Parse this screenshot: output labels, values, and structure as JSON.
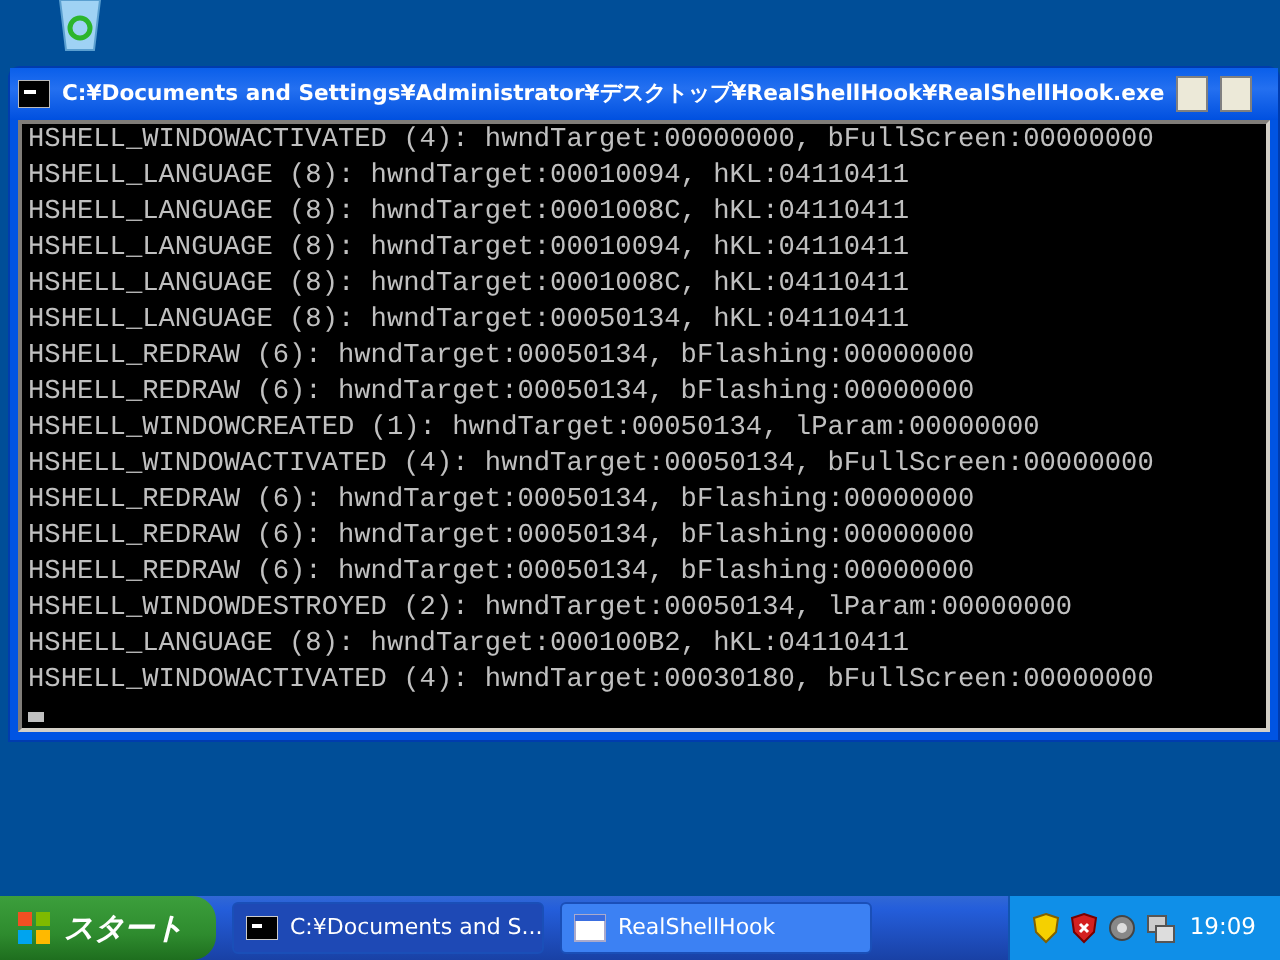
{
  "console": {
    "title": "C:¥Documents and Settings¥Administrator¥デスクトップ¥RealShellHook¥RealShellHook.exe",
    "lines": [
      "HSHELL_WINDOWACTIVATED (4): hwndTarget:00000000, bFullScreen:00000000",
      "HSHELL_LANGUAGE (8): hwndTarget:00010094, hKL:04110411",
      "HSHELL_LANGUAGE (8): hwndTarget:0001008C, hKL:04110411",
      "HSHELL_LANGUAGE (8): hwndTarget:00010094, hKL:04110411",
      "HSHELL_LANGUAGE (8): hwndTarget:0001008C, hKL:04110411",
      "HSHELL_LANGUAGE (8): hwndTarget:00050134, hKL:04110411",
      "HSHELL_REDRAW (6): hwndTarget:00050134, bFlashing:00000000",
      "HSHELL_REDRAW (6): hwndTarget:00050134, bFlashing:00000000",
      "HSHELL_WINDOWCREATED (1): hwndTarget:00050134, lParam:00000000",
      "HSHELL_WINDOWACTIVATED (4): hwndTarget:00050134, bFullScreen:00000000",
      "HSHELL_REDRAW (6): hwndTarget:00050134, bFlashing:00000000",
      "HSHELL_REDRAW (6): hwndTarget:00050134, bFlashing:00000000",
      "HSHELL_REDRAW (6): hwndTarget:00050134, bFlashing:00000000",
      "HSHELL_WINDOWDESTROYED (2): hwndTarget:00050134, lParam:00000000",
      "HSHELL_LANGUAGE (8): hwndTarget:000100B2, hKL:04110411",
      "HSHELL_WINDOWACTIVATED (4): hwndTarget:00030180, bFullScreen:00000000"
    ]
  },
  "taskbar": {
    "start": "スタート",
    "buttons": [
      {
        "label": "C:¥Documents and S...",
        "kind": "console",
        "selected": true
      },
      {
        "label": "RealShellHook",
        "kind": "window",
        "selected": false
      }
    ],
    "clock": "19:09"
  }
}
